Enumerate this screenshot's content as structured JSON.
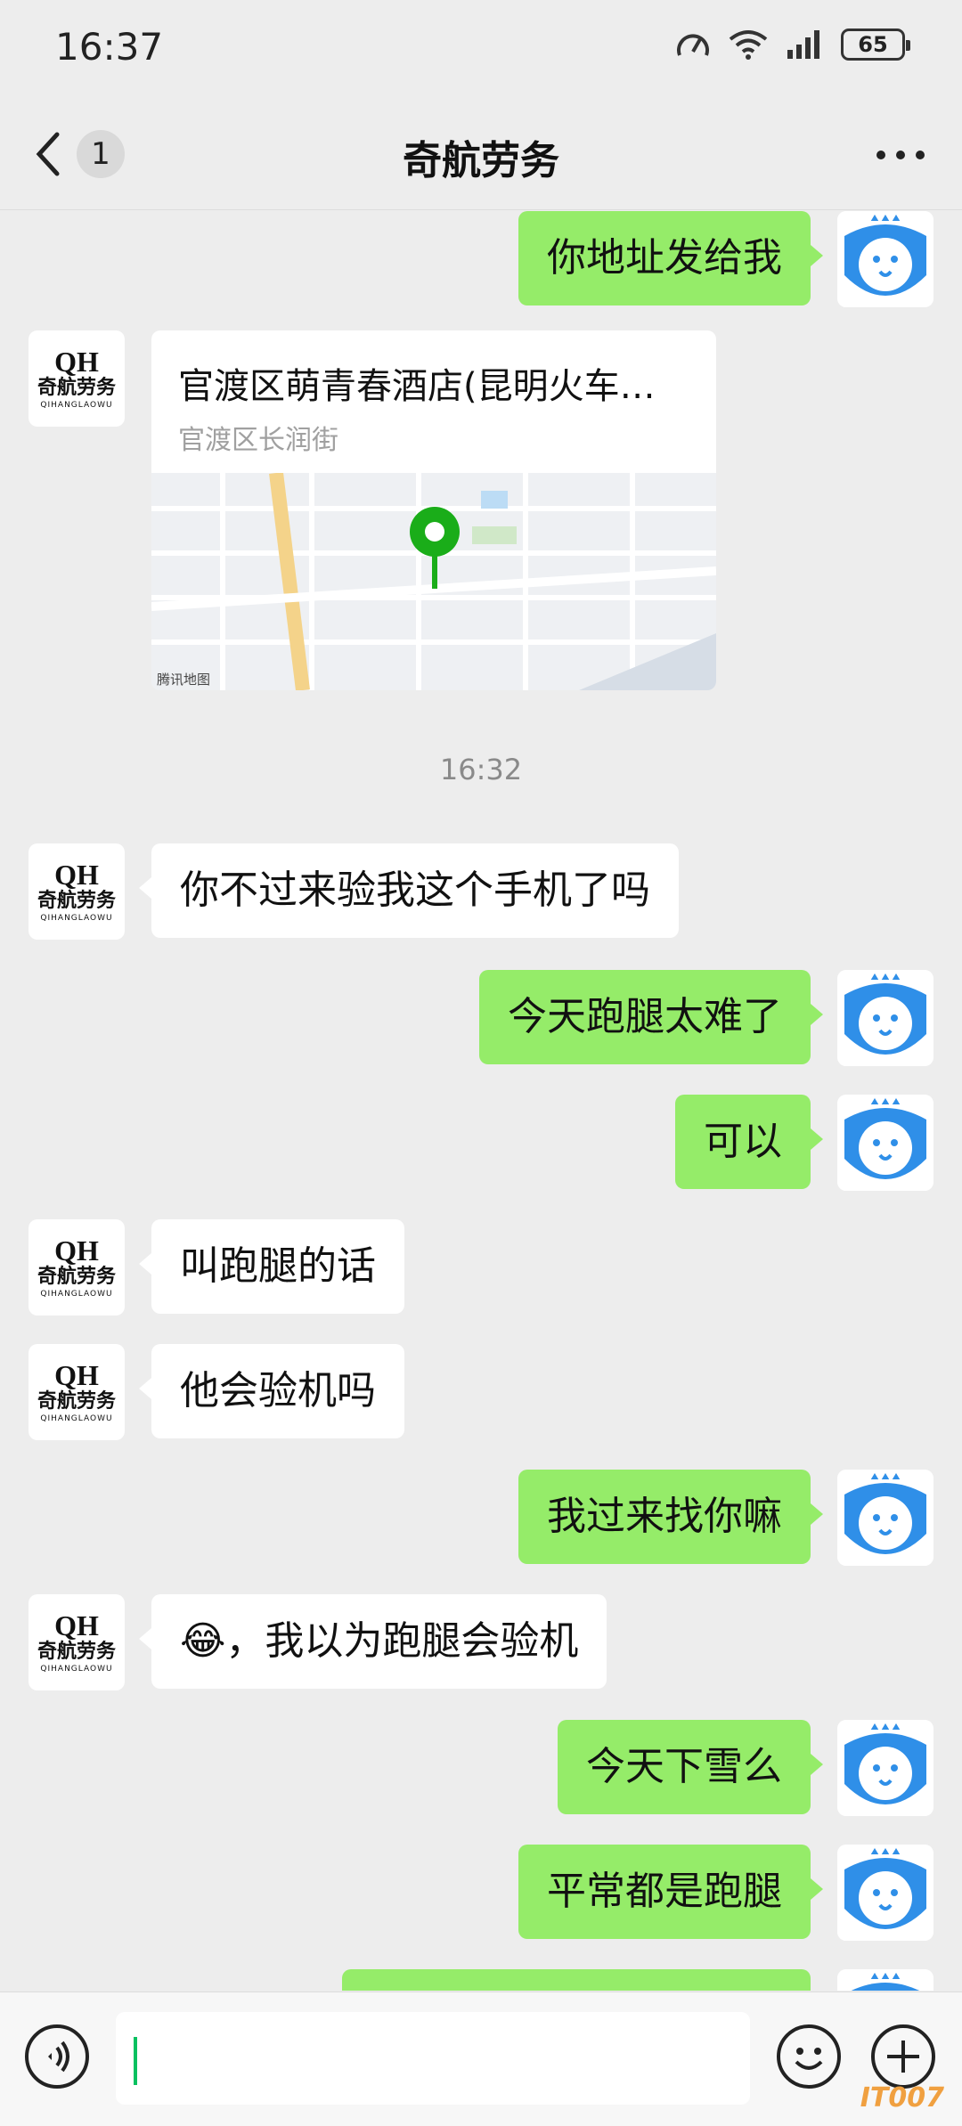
{
  "status_bar": {
    "time": "16:37",
    "battery": "65"
  },
  "nav": {
    "unread_count": "1",
    "title": "奇航劳务"
  },
  "messages": [
    {
      "text": "你地址发给我"
    },
    {
      "loc_title": "官渡区萌青春酒店(昆明火车…",
      "loc_subtitle": "官渡区长润街",
      "map_credit": "腾讯地图"
    },
    {
      "text": "16:32"
    },
    {
      "text": "你不过来验我这个手机了吗"
    },
    {
      "text": "今天跑腿太难了"
    },
    {
      "text": "可以"
    },
    {
      "text": "叫跑腿的话"
    },
    {
      "text": "他会验机吗"
    },
    {
      "text": "我过来找你嘛"
    },
    {
      "text": "😂，我以为跑腿会验机"
    },
    {
      "text": "今天下雪么"
    },
    {
      "text": "平常都是跑腿"
    }
  ],
  "avatar": {
    "brand_text": "奇航劳务",
    "brand_sub": "QIHANGLAOWU",
    "brand_mark": "QH"
  },
  "watermark": "IT007",
  "colors": {
    "background": "#ededed",
    "outgoing": "#95ec69",
    "incoming": "#ffffff",
    "cursor": "#07c160"
  }
}
